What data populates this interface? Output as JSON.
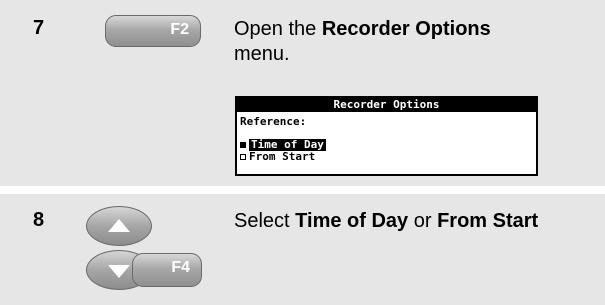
{
  "steps": [
    {
      "number": "7",
      "key": "F2",
      "desc_prefix": "Open the ",
      "desc_bold": "Recorder Options",
      "desc_suffix": " menu."
    },
    {
      "number": "8",
      "key": "F4",
      "desc_prefix": "Select ",
      "desc_bold1": "Time of Day",
      "desc_mid": " or ",
      "desc_bold2": "From Start"
    }
  ],
  "screen": {
    "title": "Recorder Options",
    "reference_label": "Reference:",
    "options": [
      {
        "label": "Time of Day",
        "selected": true
      },
      {
        "label": "From Start",
        "selected": false
      }
    ]
  },
  "icons": {
    "up": "arrow-up-icon",
    "down": "arrow-down-icon"
  }
}
